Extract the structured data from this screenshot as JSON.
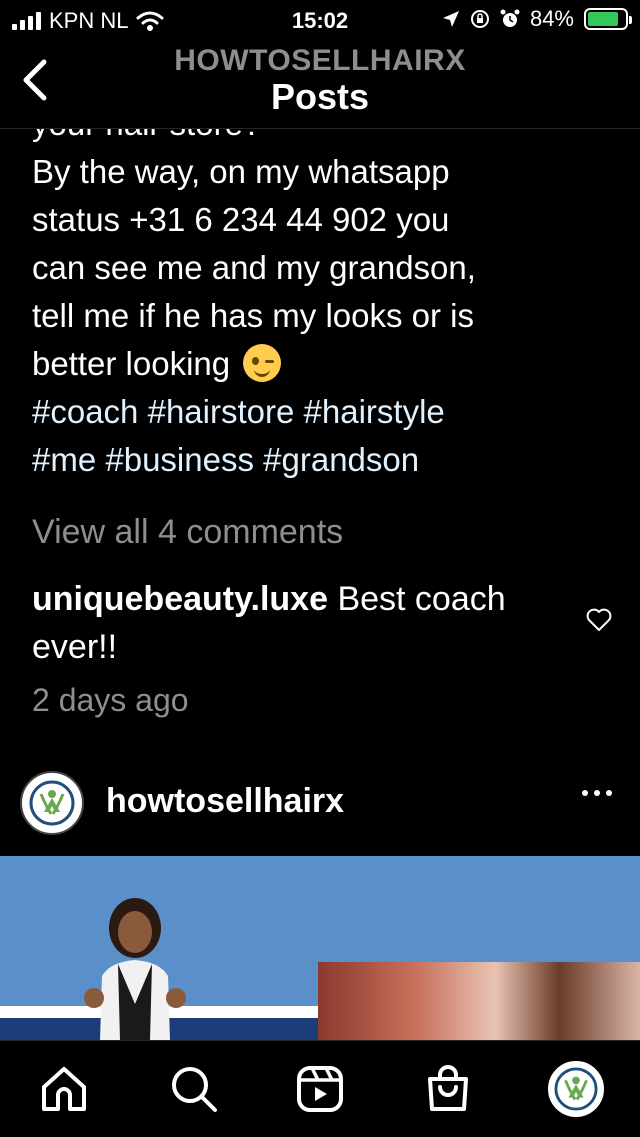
{
  "status_bar": {
    "carrier": "KPN NL",
    "time": "15:02",
    "battery": "84%",
    "battery_level": 0.84
  },
  "header": {
    "account": "HOWTOSELLHAIRX",
    "title": "Posts"
  },
  "caption": {
    "line_cut": "your hair store?",
    "lines": [
      "By the way, on my whatsapp",
      "status +31 6 234 44 902 you",
      "can see me and my grandson,",
      "tell me if he has my looks or is"
    ],
    "last_line": "better looking",
    "emoji": "winking-face-emoji",
    "hashtags_line1": [
      "#coach",
      "#hairstore",
      "#hairstyle"
    ],
    "hashtags_line2": [
      "#me",
      "#business",
      "#grandson"
    ]
  },
  "comments": {
    "view_all": "View all 4 comments",
    "preview": {
      "username": "uniquebeauty.luxe",
      "text": "Best coach ever!!"
    },
    "time_ago": "2 days ago"
  },
  "next_post": {
    "username": "howtosellhairx"
  },
  "bottom_nav": [
    "home-icon",
    "search-icon",
    "reels-icon",
    "shop-icon",
    "profile-avatar"
  ],
  "colors": {
    "background": "#000000",
    "secondary_text": "#8e8e8e",
    "hashtag": "#e0f1ff",
    "battery": "#34c759"
  }
}
